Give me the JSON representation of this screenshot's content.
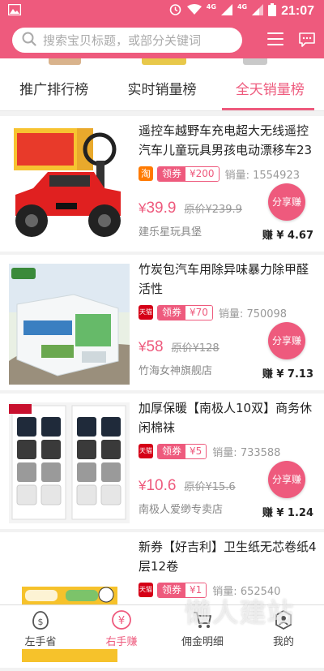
{
  "status_bar": {
    "time": "21:07",
    "network_1": "4G",
    "network_2": "4G",
    "icons": [
      "image-icon",
      "alarm-icon",
      "wifi-icon",
      "signal-icon",
      "signal-icon",
      "battery-icon"
    ]
  },
  "header": {
    "search_placeholder": "搜索宝贝标题，或部分关键词",
    "accent_color": "#ee5a7d"
  },
  "tabs": [
    {
      "label": "推广排行榜",
      "active": false
    },
    {
      "label": "实时销量榜",
      "active": false
    },
    {
      "label": "全天销量榜",
      "active": true
    }
  ],
  "products": [
    {
      "title": "遥控车越野车充电超大无线遥控汽车儿童玩具男孩电动漂移车23",
      "platform": "淘",
      "coupon_label": "领券",
      "coupon_value": "¥200",
      "sales_label": "销量:",
      "sales": "1554923",
      "price_symbol": "¥",
      "price": "39.9",
      "original_price": "原价¥239.9",
      "shop": "建乐星玩具堡",
      "share_label": "分享赚",
      "earn": "赚 ¥ 4.67"
    },
    {
      "title": "竹炭包汽车用除异味暴力除甲醛活性",
      "platform": "天猫",
      "coupon_label": "领券",
      "coupon_value": "¥70",
      "sales_label": "销量:",
      "sales": "750098",
      "price_symbol": "¥",
      "price": "58",
      "original_price": "原价¥128",
      "shop": "竹海女神旗舰店",
      "share_label": "分享赚",
      "earn": "赚 ¥ 7.13"
    },
    {
      "title": "加厚保暖【南极人10双】商务休闲棉袜",
      "platform": "天猫",
      "coupon_label": "领券",
      "coupon_value": "¥5",
      "sales_label": "销量:",
      "sales": "733588",
      "price_symbol": "¥",
      "price": "10.6",
      "original_price": "原价¥15.6",
      "shop": "南极人爱缈专卖店",
      "share_label": "分享赚",
      "earn": "赚 ¥ 1.24"
    },
    {
      "title": "新券【好吉利】卫生纸无芯卷纸4层12卷",
      "platform": "天猫",
      "coupon_label": "领券",
      "coupon_value": "¥1",
      "sales_label": "销量:",
      "sales": "652540"
    }
  ],
  "bottom_nav": [
    {
      "label": "左手省",
      "icon": "savings-icon",
      "active": false
    },
    {
      "label": "右手赚",
      "icon": "yuan-icon",
      "active": true
    },
    {
      "label": "佣金明细",
      "icon": "cart-icon",
      "active": false
    },
    {
      "label": "我的",
      "icon": "profile-icon",
      "active": false
    }
  ],
  "watermark": "懒人建站"
}
